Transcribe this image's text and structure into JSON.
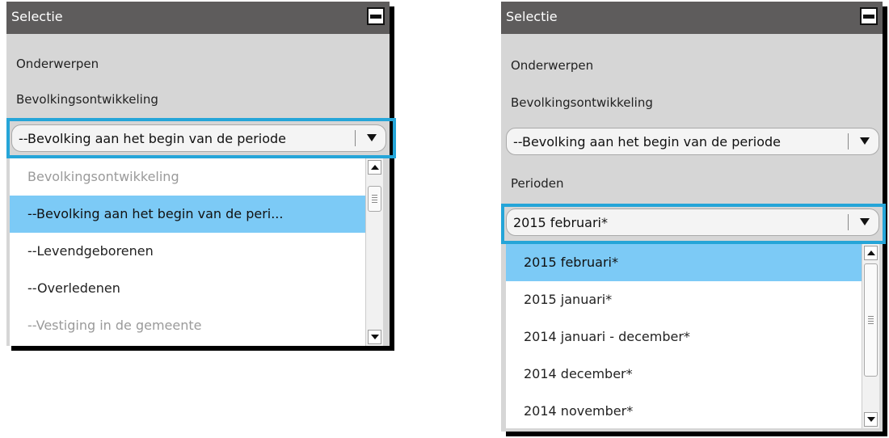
{
  "left": {
    "title": "Selectie",
    "onderwerpen_label": "Onderwerpen",
    "bevolking_label": "Bevolkingsontwikkeling",
    "combo_value": "--Bevolking aan het begin van de periode",
    "list_items": [
      {
        "label": "Bevolkingsontwikkeling",
        "state": "disabled"
      },
      {
        "label": "--Bevolking aan het begin van de peri...",
        "state": "selected"
      },
      {
        "label": "--Levendgeborenen",
        "state": "normal"
      },
      {
        "label": "--Overledenen",
        "state": "normal"
      },
      {
        "label": "--Vestiging in de gemeente",
        "state": "disabled"
      }
    ]
  },
  "right": {
    "title": "Selectie",
    "onderwerpen_label": "Onderwerpen",
    "bevolking_label": "Bevolkingsontwikkeling",
    "combo1_value": "--Bevolking aan het begin van de periode",
    "perioden_label": "Perioden",
    "combo2_value": "2015 februari*",
    "list_items": [
      {
        "label": "2015 februari*",
        "state": "selected"
      },
      {
        "label": "2015 januari*",
        "state": "normal"
      },
      {
        "label": "2014 januari - december*",
        "state": "normal"
      },
      {
        "label": "2014 december*",
        "state": "normal"
      },
      {
        "label": "2014 november*",
        "state": "normal"
      }
    ]
  },
  "colors": {
    "highlight": "#25a5d8",
    "selected_row": "#7ccaf6",
    "titlebar": "#5e5c5c",
    "panel": "#d6d6d6"
  },
  "icons": [
    "minimize-icon",
    "dropdown-arrow-icon",
    "scroll-up-icon",
    "scroll-down-icon"
  ]
}
